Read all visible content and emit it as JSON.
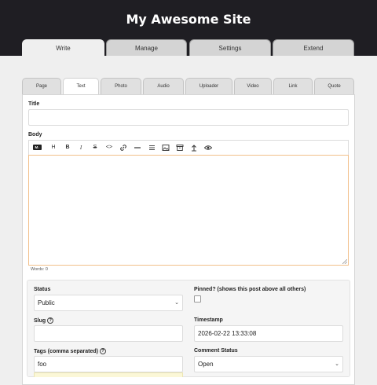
{
  "site": {
    "title": "My Awesome Site"
  },
  "main_tabs": [
    {
      "label": "Write"
    },
    {
      "label": "Manage"
    },
    {
      "label": "Settings"
    },
    {
      "label": "Extend"
    }
  ],
  "post_tabs": [
    {
      "label": "Page"
    },
    {
      "label": "Text"
    },
    {
      "label": "Photo"
    },
    {
      "label": "Audio"
    },
    {
      "label": "Uploader"
    },
    {
      "label": "Video"
    },
    {
      "label": "Link"
    },
    {
      "label": "Quote"
    }
  ],
  "form": {
    "title_label": "Title",
    "title_value": "",
    "body_label": "Body",
    "toolbar": {
      "markdown_badge": "M↓",
      "icons": [
        "markdown-icon",
        "heading-icon",
        "bold-icon",
        "italic-icon",
        "strikethrough-icon",
        "code-icon",
        "link-icon",
        "horizontal-rule-icon",
        "list-icon",
        "image-icon",
        "archive-icon",
        "upload-icon",
        "preview-eye-icon"
      ]
    },
    "word_count": "Words: 0",
    "status_label": "Status",
    "status_value": "Public",
    "pinned_label": "Pinned? (shows this post above all others)",
    "slug_label": "Slug",
    "slug_value": "",
    "timestamp_label": "Timestamp",
    "timestamp_value": "2026-02-22 13:33:08",
    "tags_label": "Tags (comma separated)",
    "tags_value": "foo",
    "comment_status_label": "Comment Status",
    "comment_status_value": "Open"
  },
  "colors": {
    "header_bg": "#1f1e23",
    "editor_focus_border": "#f2c08a",
    "page_bg": "#efefef"
  }
}
